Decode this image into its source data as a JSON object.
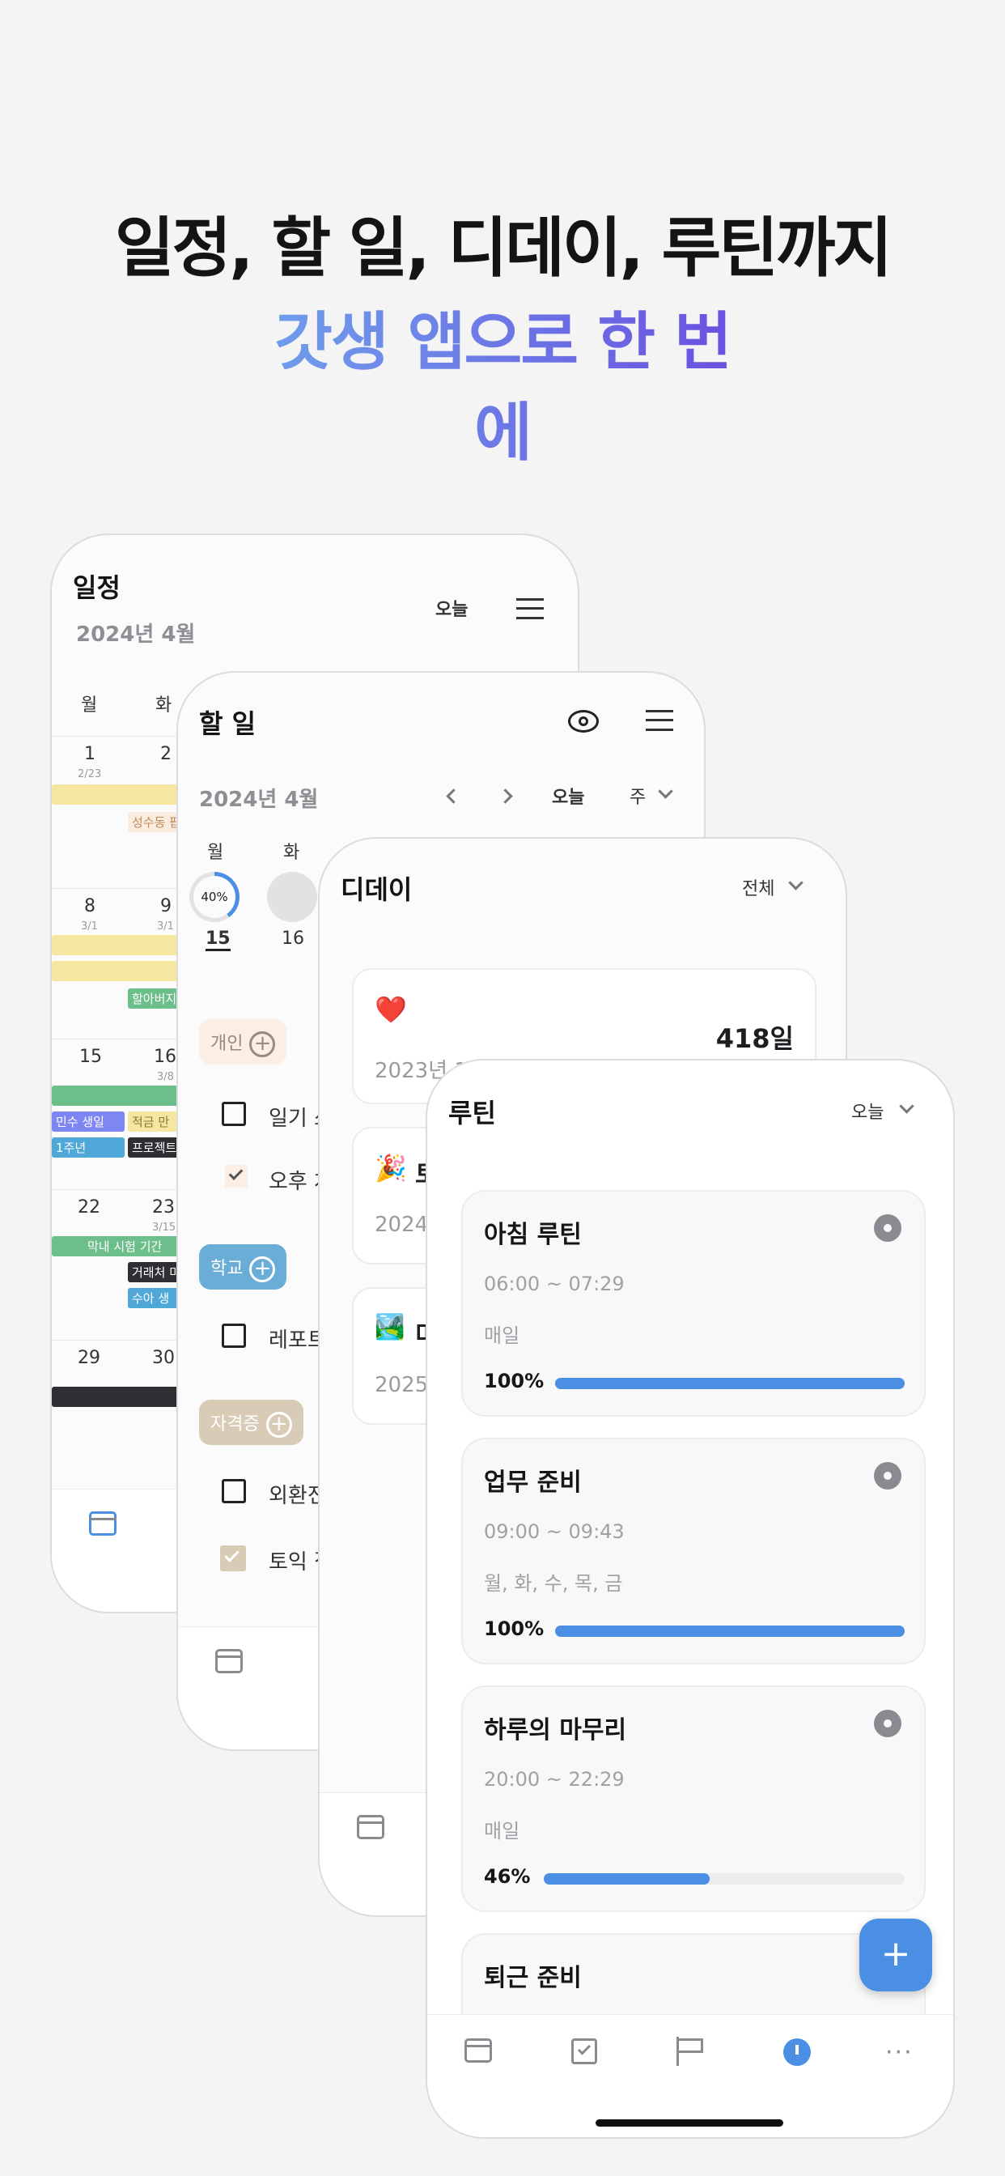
{
  "headline": {
    "line1": "일정, 할 일, 디데이, 루틴까지",
    "line2": "갓생 앱으로 한 번에"
  },
  "schedule": {
    "title": "일정",
    "month": "2024년 4월",
    "today": "오늘",
    "weekdays": [
      "월",
      "화"
    ],
    "weeks": [
      {
        "d1": "1",
        "l1": "2/23",
        "d2": "2",
        "l2": ""
      },
      {
        "d1": "8",
        "l1": "3/1",
        "d2": "9",
        "l2": "3/1"
      },
      {
        "d1": "15",
        "l1": "",
        "d2": "16",
        "l2": "3/8"
      },
      {
        "d1": "22",
        "l1": "",
        "d2": "23",
        "l2": "3/15"
      },
      {
        "d1": "29",
        "l1": "",
        "d2": "30",
        "l2": ""
      }
    ],
    "events": {
      "seongsu": "성수동 팝",
      "grandpa": "할아버지",
      "minsu": "민수 생일",
      "savings": "적금 만",
      "week1": "1주년",
      "project": "프로젝트",
      "exam": "막내 시험 기간",
      "client": "거래처 미",
      "suah": "수아 생"
    },
    "icons": {
      "menu": "menu-icon",
      "calendar_tab": "calendar-icon"
    }
  },
  "todo": {
    "title": "할 일",
    "month": "2024년 4월",
    "today": "오늘",
    "view": "주",
    "weekdays": [
      "월",
      "화"
    ],
    "days": [
      {
        "date": "15",
        "progress": "40%"
      },
      {
        "date": "16"
      }
    ],
    "groups": {
      "personal": "개인",
      "school": "학교",
      "cert": "자격증"
    },
    "items": {
      "diary": "일기 쓰",
      "afternoon": "오후 차",
      "report": "레포트",
      "exchange": "외환전",
      "toeic": "토익 접"
    },
    "progress_value": 40
  },
  "dday": {
    "title": "디데이",
    "filter": "전체",
    "items": [
      {
        "emoji": "❤️",
        "date": "2023년 12월 1일",
        "count": "418일"
      },
      {
        "emoji": "🎉",
        "name": "토",
        "date": "2024"
      },
      {
        "emoji": "🏞️",
        "name": "미",
        "date": "2025"
      }
    ]
  },
  "routine": {
    "title": "루틴",
    "filter": "오늘",
    "items": [
      {
        "name": "아침 루틴",
        "time": "06:00 ~ 07:29",
        "days": "매일",
        "percent": "100%",
        "value": 100
      },
      {
        "name": "업무 준비",
        "time": "09:00 ~ 09:43",
        "days": "월, 화, 수, 목, 금",
        "percent": "100%",
        "value": 100
      },
      {
        "name": "하루의 마무리",
        "time": "20:00 ~ 22:29",
        "days": "매일",
        "percent": "46%",
        "value": 46
      },
      {
        "name": "퇴근 준비"
      }
    ],
    "fab": "+",
    "tabs": [
      "calendar-icon",
      "checkbox-icon",
      "flag-icon",
      "timer-icon",
      "more-icon"
    ],
    "accent": "#4a8fe4"
  }
}
